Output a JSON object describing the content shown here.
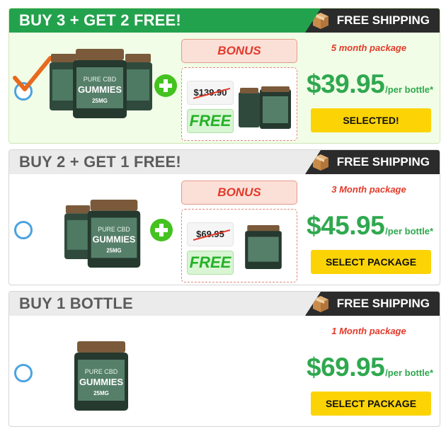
{
  "colors": {
    "green_header": "#23a24d",
    "dark_banner": "#2b2b2b",
    "gray_header": "#ebebeb",
    "price_green": "#2fa84f",
    "bonus_red": "#e23a2a",
    "button_yellow": "#fcd405",
    "radio_blue": "#4ba3e0",
    "check_orange": "#e86a1c"
  },
  "packages": [
    {
      "title": "BUY 3 + GET 2 FREE!",
      "shipping": "FREE SHIPPING",
      "bonus_label": "BONUS",
      "old_price": "$139.90",
      "free_label": "FREE",
      "package_label": "5 month package",
      "price": "$39.95",
      "per_bottle": "/per bottle*",
      "button": "SELECTED!",
      "selected": true,
      "jar_label": "PURE CBD",
      "jar_brand": "GUMMIES",
      "jar_mg": "25MG"
    },
    {
      "title": "BUY 2 + GET 1 FREE!",
      "shipping": "FREE SHIPPING",
      "bonus_label": "BONUS",
      "old_price": "$69.95",
      "free_label": "FREE",
      "package_label": "3 Month package",
      "price": "$45.95",
      "per_bottle": "/per bottle*",
      "button": "SELECT PACKAGE",
      "selected": false,
      "jar_label": "PURE CBD",
      "jar_brand": "GUMMIES",
      "jar_mg": "25MG"
    },
    {
      "title": "BUY 1 BOTTLE",
      "shipping": "FREE SHIPPING",
      "package_label": "1 Month package",
      "price": "$69.95",
      "per_bottle": "/per bottle*",
      "button": "SELECT PACKAGE",
      "selected": false,
      "jar_label": "PURE CBD",
      "jar_brand": "GUMMIES",
      "jar_mg": "25MG"
    }
  ],
  "icons": {
    "shipping": "shipping-box-icon",
    "plus": "plus-circle-icon",
    "check": "checkmark-icon",
    "radio": "radio-button"
  }
}
